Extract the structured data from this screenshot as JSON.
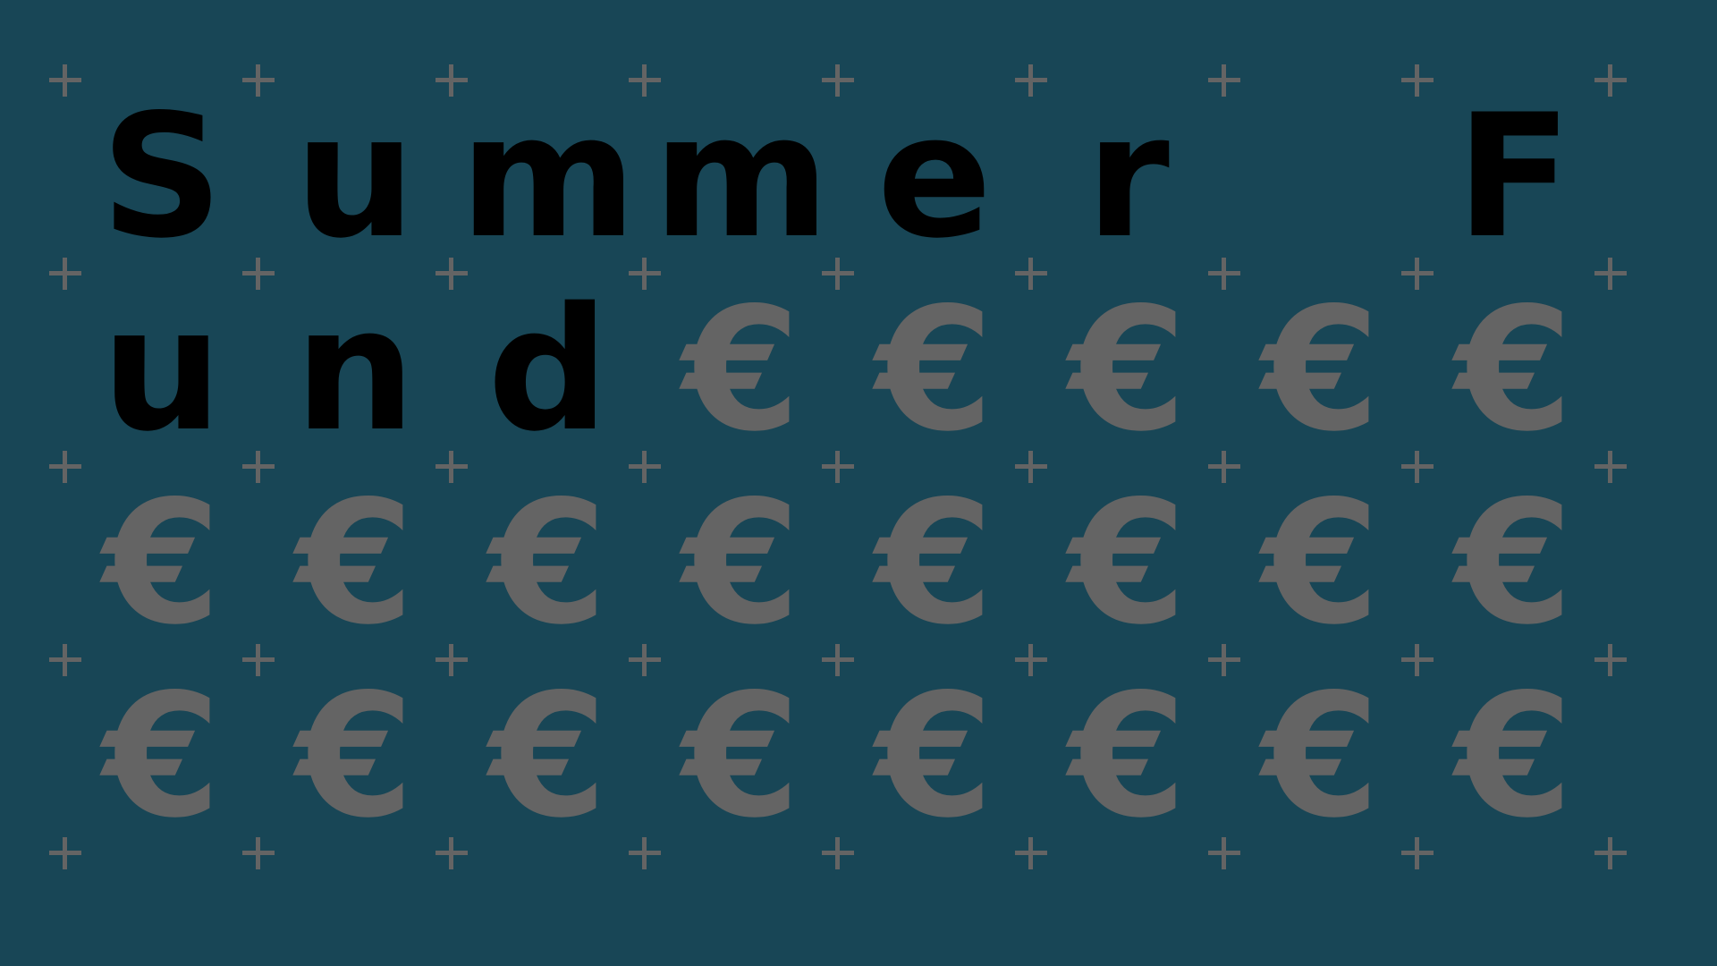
{
  "title_chars": [
    "S",
    "u",
    "m",
    "m",
    "e",
    "r",
    "",
    "F",
    "u",
    "n",
    "d"
  ],
  "fill_glyph": "€",
  "grid": {
    "columns": 8,
    "rows": 4
  },
  "colors": {
    "background": "#184656",
    "text": "#000000",
    "glyph": "#646464",
    "plus": "#646464"
  },
  "icons": {
    "grid_marker": "plus-icon",
    "fill": "euro-sign-icon"
  }
}
